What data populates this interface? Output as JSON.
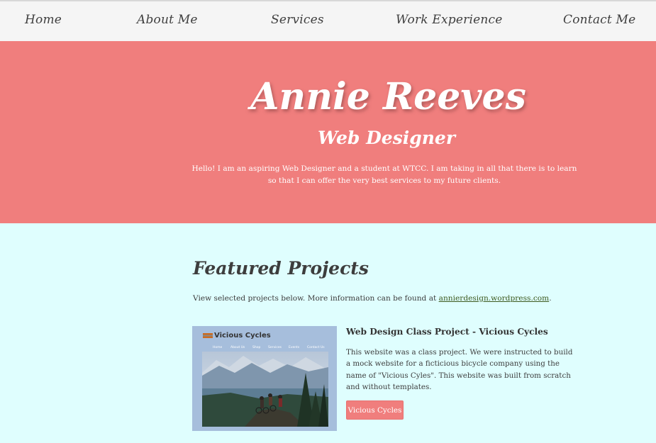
{
  "nav": {
    "items": [
      {
        "label": "Home"
      },
      {
        "label": "About Me"
      },
      {
        "label": "Services"
      },
      {
        "label": "Work Experience"
      },
      {
        "label": "Contact Me"
      }
    ]
  },
  "hero": {
    "name": "Annie Reeves",
    "title": "Web Designer",
    "intro": "Hello! I am an aspiring Web Designer and a student at WTCC. I am taking in all that there is to learn so that I can offer the very best services to my future clients."
  },
  "projects": {
    "heading": "Featured Projects",
    "intro_prefix": "View selected projects below. More information can be found at ",
    "intro_link": "annierdesign.wordpress.com",
    "intro_suffix": ".",
    "items": [
      {
        "title": "Web Design Class Project - Vicious Cycles",
        "description": "This website was a class project. We were instructed to build a mock website for a ficticious bicycle company using the name of \"Vicious Cyles\". This website was built from scratch and without templates.",
        "button_label": "Vicious Cycles",
        "thumbnail": {
          "logo": "Vicious Cycles",
          "nav": [
            "Home",
            "About Us",
            "Shop",
            "Services",
            "Events",
            "Contact Us"
          ]
        }
      }
    ]
  },
  "colors": {
    "hero_bg": "#f07e7d",
    "nav_bg": "#f5f5f5",
    "page_bg": "#dffefe",
    "link": "#3d5a1f"
  }
}
